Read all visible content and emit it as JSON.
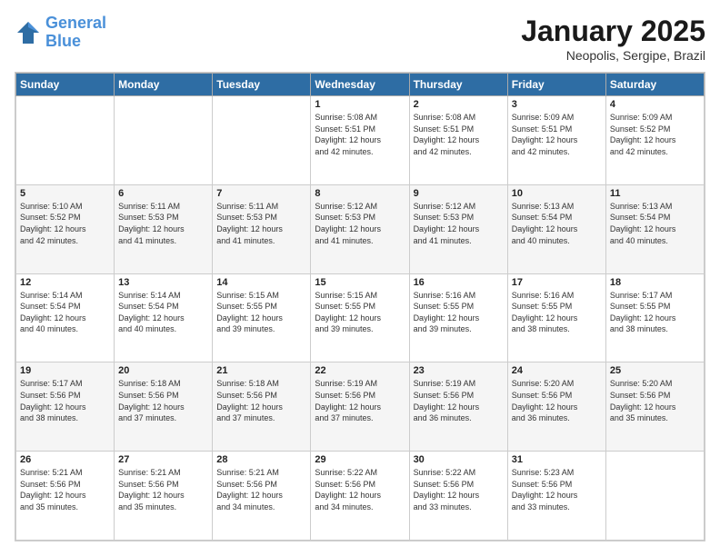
{
  "header": {
    "logo_line1": "General",
    "logo_line2": "Blue",
    "month": "January 2025",
    "location": "Neopolis, Sergipe, Brazil"
  },
  "days_of_week": [
    "Sunday",
    "Monday",
    "Tuesday",
    "Wednesday",
    "Thursday",
    "Friday",
    "Saturday"
  ],
  "weeks": [
    [
      {
        "day": "",
        "info": ""
      },
      {
        "day": "",
        "info": ""
      },
      {
        "day": "",
        "info": ""
      },
      {
        "day": "1",
        "info": "Sunrise: 5:08 AM\nSunset: 5:51 PM\nDaylight: 12 hours\nand 42 minutes."
      },
      {
        "day": "2",
        "info": "Sunrise: 5:08 AM\nSunset: 5:51 PM\nDaylight: 12 hours\nand 42 minutes."
      },
      {
        "day": "3",
        "info": "Sunrise: 5:09 AM\nSunset: 5:51 PM\nDaylight: 12 hours\nand 42 minutes."
      },
      {
        "day": "4",
        "info": "Sunrise: 5:09 AM\nSunset: 5:52 PM\nDaylight: 12 hours\nand 42 minutes."
      }
    ],
    [
      {
        "day": "5",
        "info": "Sunrise: 5:10 AM\nSunset: 5:52 PM\nDaylight: 12 hours\nand 42 minutes."
      },
      {
        "day": "6",
        "info": "Sunrise: 5:11 AM\nSunset: 5:53 PM\nDaylight: 12 hours\nand 41 minutes."
      },
      {
        "day": "7",
        "info": "Sunrise: 5:11 AM\nSunset: 5:53 PM\nDaylight: 12 hours\nand 41 minutes."
      },
      {
        "day": "8",
        "info": "Sunrise: 5:12 AM\nSunset: 5:53 PM\nDaylight: 12 hours\nand 41 minutes."
      },
      {
        "day": "9",
        "info": "Sunrise: 5:12 AM\nSunset: 5:53 PM\nDaylight: 12 hours\nand 41 minutes."
      },
      {
        "day": "10",
        "info": "Sunrise: 5:13 AM\nSunset: 5:54 PM\nDaylight: 12 hours\nand 40 minutes."
      },
      {
        "day": "11",
        "info": "Sunrise: 5:13 AM\nSunset: 5:54 PM\nDaylight: 12 hours\nand 40 minutes."
      }
    ],
    [
      {
        "day": "12",
        "info": "Sunrise: 5:14 AM\nSunset: 5:54 PM\nDaylight: 12 hours\nand 40 minutes."
      },
      {
        "day": "13",
        "info": "Sunrise: 5:14 AM\nSunset: 5:54 PM\nDaylight: 12 hours\nand 40 minutes."
      },
      {
        "day": "14",
        "info": "Sunrise: 5:15 AM\nSunset: 5:55 PM\nDaylight: 12 hours\nand 39 minutes."
      },
      {
        "day": "15",
        "info": "Sunrise: 5:15 AM\nSunset: 5:55 PM\nDaylight: 12 hours\nand 39 minutes."
      },
      {
        "day": "16",
        "info": "Sunrise: 5:16 AM\nSunset: 5:55 PM\nDaylight: 12 hours\nand 39 minutes."
      },
      {
        "day": "17",
        "info": "Sunrise: 5:16 AM\nSunset: 5:55 PM\nDaylight: 12 hours\nand 38 minutes."
      },
      {
        "day": "18",
        "info": "Sunrise: 5:17 AM\nSunset: 5:55 PM\nDaylight: 12 hours\nand 38 minutes."
      }
    ],
    [
      {
        "day": "19",
        "info": "Sunrise: 5:17 AM\nSunset: 5:56 PM\nDaylight: 12 hours\nand 38 minutes."
      },
      {
        "day": "20",
        "info": "Sunrise: 5:18 AM\nSunset: 5:56 PM\nDaylight: 12 hours\nand 37 minutes."
      },
      {
        "day": "21",
        "info": "Sunrise: 5:18 AM\nSunset: 5:56 PM\nDaylight: 12 hours\nand 37 minutes."
      },
      {
        "day": "22",
        "info": "Sunrise: 5:19 AM\nSunset: 5:56 PM\nDaylight: 12 hours\nand 37 minutes."
      },
      {
        "day": "23",
        "info": "Sunrise: 5:19 AM\nSunset: 5:56 PM\nDaylight: 12 hours\nand 36 minutes."
      },
      {
        "day": "24",
        "info": "Sunrise: 5:20 AM\nSunset: 5:56 PM\nDaylight: 12 hours\nand 36 minutes."
      },
      {
        "day": "25",
        "info": "Sunrise: 5:20 AM\nSunset: 5:56 PM\nDaylight: 12 hours\nand 35 minutes."
      }
    ],
    [
      {
        "day": "26",
        "info": "Sunrise: 5:21 AM\nSunset: 5:56 PM\nDaylight: 12 hours\nand 35 minutes."
      },
      {
        "day": "27",
        "info": "Sunrise: 5:21 AM\nSunset: 5:56 PM\nDaylight: 12 hours\nand 35 minutes."
      },
      {
        "day": "28",
        "info": "Sunrise: 5:21 AM\nSunset: 5:56 PM\nDaylight: 12 hours\nand 34 minutes."
      },
      {
        "day": "29",
        "info": "Sunrise: 5:22 AM\nSunset: 5:56 PM\nDaylight: 12 hours\nand 34 minutes."
      },
      {
        "day": "30",
        "info": "Sunrise: 5:22 AM\nSunset: 5:56 PM\nDaylight: 12 hours\nand 33 minutes."
      },
      {
        "day": "31",
        "info": "Sunrise: 5:23 AM\nSunset: 5:56 PM\nDaylight: 12 hours\nand 33 minutes."
      },
      {
        "day": "",
        "info": ""
      }
    ]
  ]
}
